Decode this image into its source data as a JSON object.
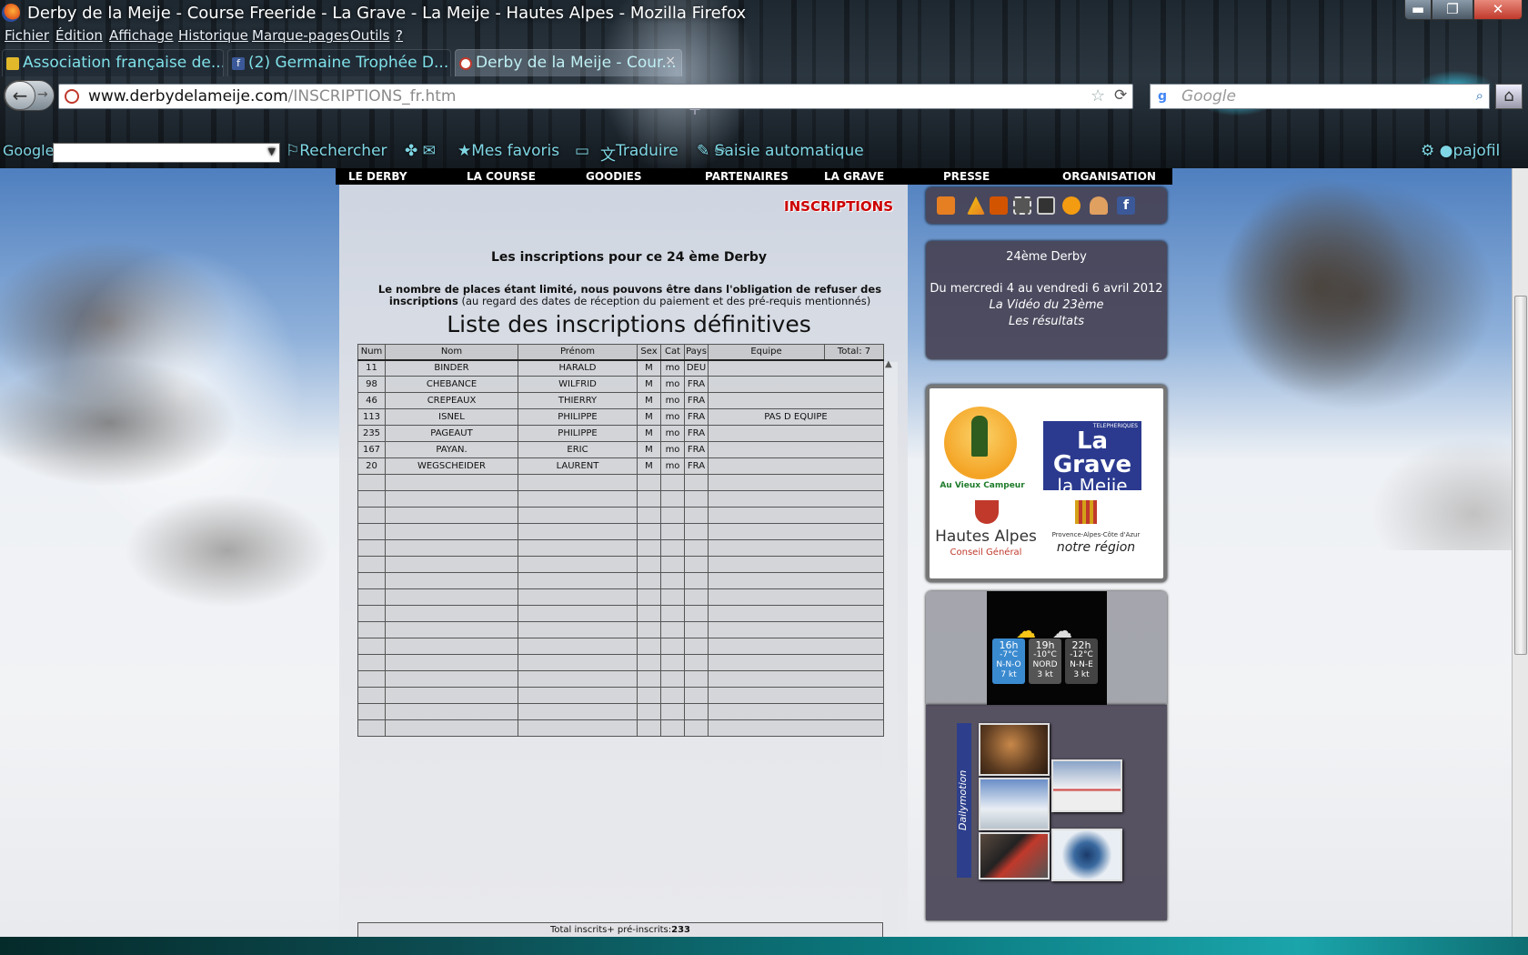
{
  "window": {
    "title": "Derby de la Meije - Course Freeride - La Grave - La Meije - Hautes Alpes - Mozilla Firefox"
  },
  "menu": [
    "Fichier",
    "Édition",
    "Affichage",
    "Historique",
    "Marque-pages",
    "Outils",
    "?"
  ],
  "tabs": [
    {
      "label": "Association française de..."
    },
    {
      "label": "(2) Germaine Trophée D..."
    },
    {
      "label": "Derby de la Meije - Cour..."
    }
  ],
  "address": {
    "host": "www.derbydelameije.com",
    "path": "/INSCRIPTIONS_fr.htm"
  },
  "search": {
    "placeholder": "Google"
  },
  "google_toolbar": {
    "logo": "Google",
    "search": "Rechercher",
    "favorites": "Mes favoris",
    "translate": "Traduire",
    "autofill": "Saisie automatique",
    "user": "pajofil"
  },
  "site_nav": [
    "LE DERBY",
    "LA COURSE",
    "GOODIES",
    "PARTENAIRES",
    "LA GRAVE",
    "PRESSE",
    "ORGANISATION"
  ],
  "page": {
    "section_title": "INSCRIPTIONS",
    "heading": "Les inscriptions pour ce 24 ème Derby",
    "notice_bold": "Le nombre de places étant limité, nous pouvons être dans l'obligation de refuser des inscriptions",
    "notice_rest": "(au regard des dates de réception du paiement et des pré-requis mentionnés)",
    "list_title": "Liste des inscriptions définitives"
  },
  "table": {
    "headers": [
      "Num",
      "Nom",
      "Prénom",
      "Sex",
      "Cat",
      "Pays",
      "Equipe",
      "Total: 7"
    ],
    "rows": [
      [
        "11",
        "BINDER",
        "HARALD",
        "M",
        "mo",
        "DEU",
        ""
      ],
      [
        "98",
        "CHEBANCE",
        "WILFRID",
        "M",
        "mo",
        "FRA",
        ""
      ],
      [
        "46",
        "CREPEAUX",
        "THIERRY",
        "M",
        "mo",
        "FRA",
        ""
      ],
      [
        "113",
        "ISNEL",
        "PHILIPPE",
        "M",
        "mo",
        "FRA",
        "PAS D EQUIPE"
      ],
      [
        "235",
        "PAGEAUT",
        "PHILIPPE",
        "M",
        "mo",
        "FRA",
        ""
      ],
      [
        "167",
        "PAYAN.",
        "ERIC",
        "M",
        "mo",
        "FRA",
        ""
      ],
      [
        "20",
        "WEGSCHEIDER",
        "LAURENT",
        "M",
        "mo",
        "FRA",
        ""
      ]
    ],
    "total_label": "Total inscrits+ pré-inscrits:",
    "total_value": "233"
  },
  "sidebar": {
    "event_title": "24ème Derby",
    "event_dates": "Du mercredi 4 au vendredi 6 avril 2012",
    "video_link": "La Vidéo du 23ème",
    "results_link": "Les résultats",
    "sponsors": {
      "s1": "Au Vieux Campeur",
      "s2a": "La Grave",
      "s2b": "la Meije",
      "s2c": "TELEPHERIQUES",
      "s3a": "Hautes Alpes",
      "s3b": "Conseil Général",
      "s4a": "Provence-Alpes-Côte d'Azur",
      "s4b": "notre région"
    },
    "weather": [
      {
        "hour": "16h",
        "temp": "-7°C",
        "wind": "N-N-O",
        "speed": "7 kt"
      },
      {
        "hour": "19h",
        "temp": "-10°C",
        "wind": "NORD",
        "speed": "3 kt"
      },
      {
        "hour": "22h",
        "temp": "-12°C",
        "wind": "N-N-E",
        "speed": "3 kt"
      }
    ],
    "video_brand": "Dailymotion"
  }
}
